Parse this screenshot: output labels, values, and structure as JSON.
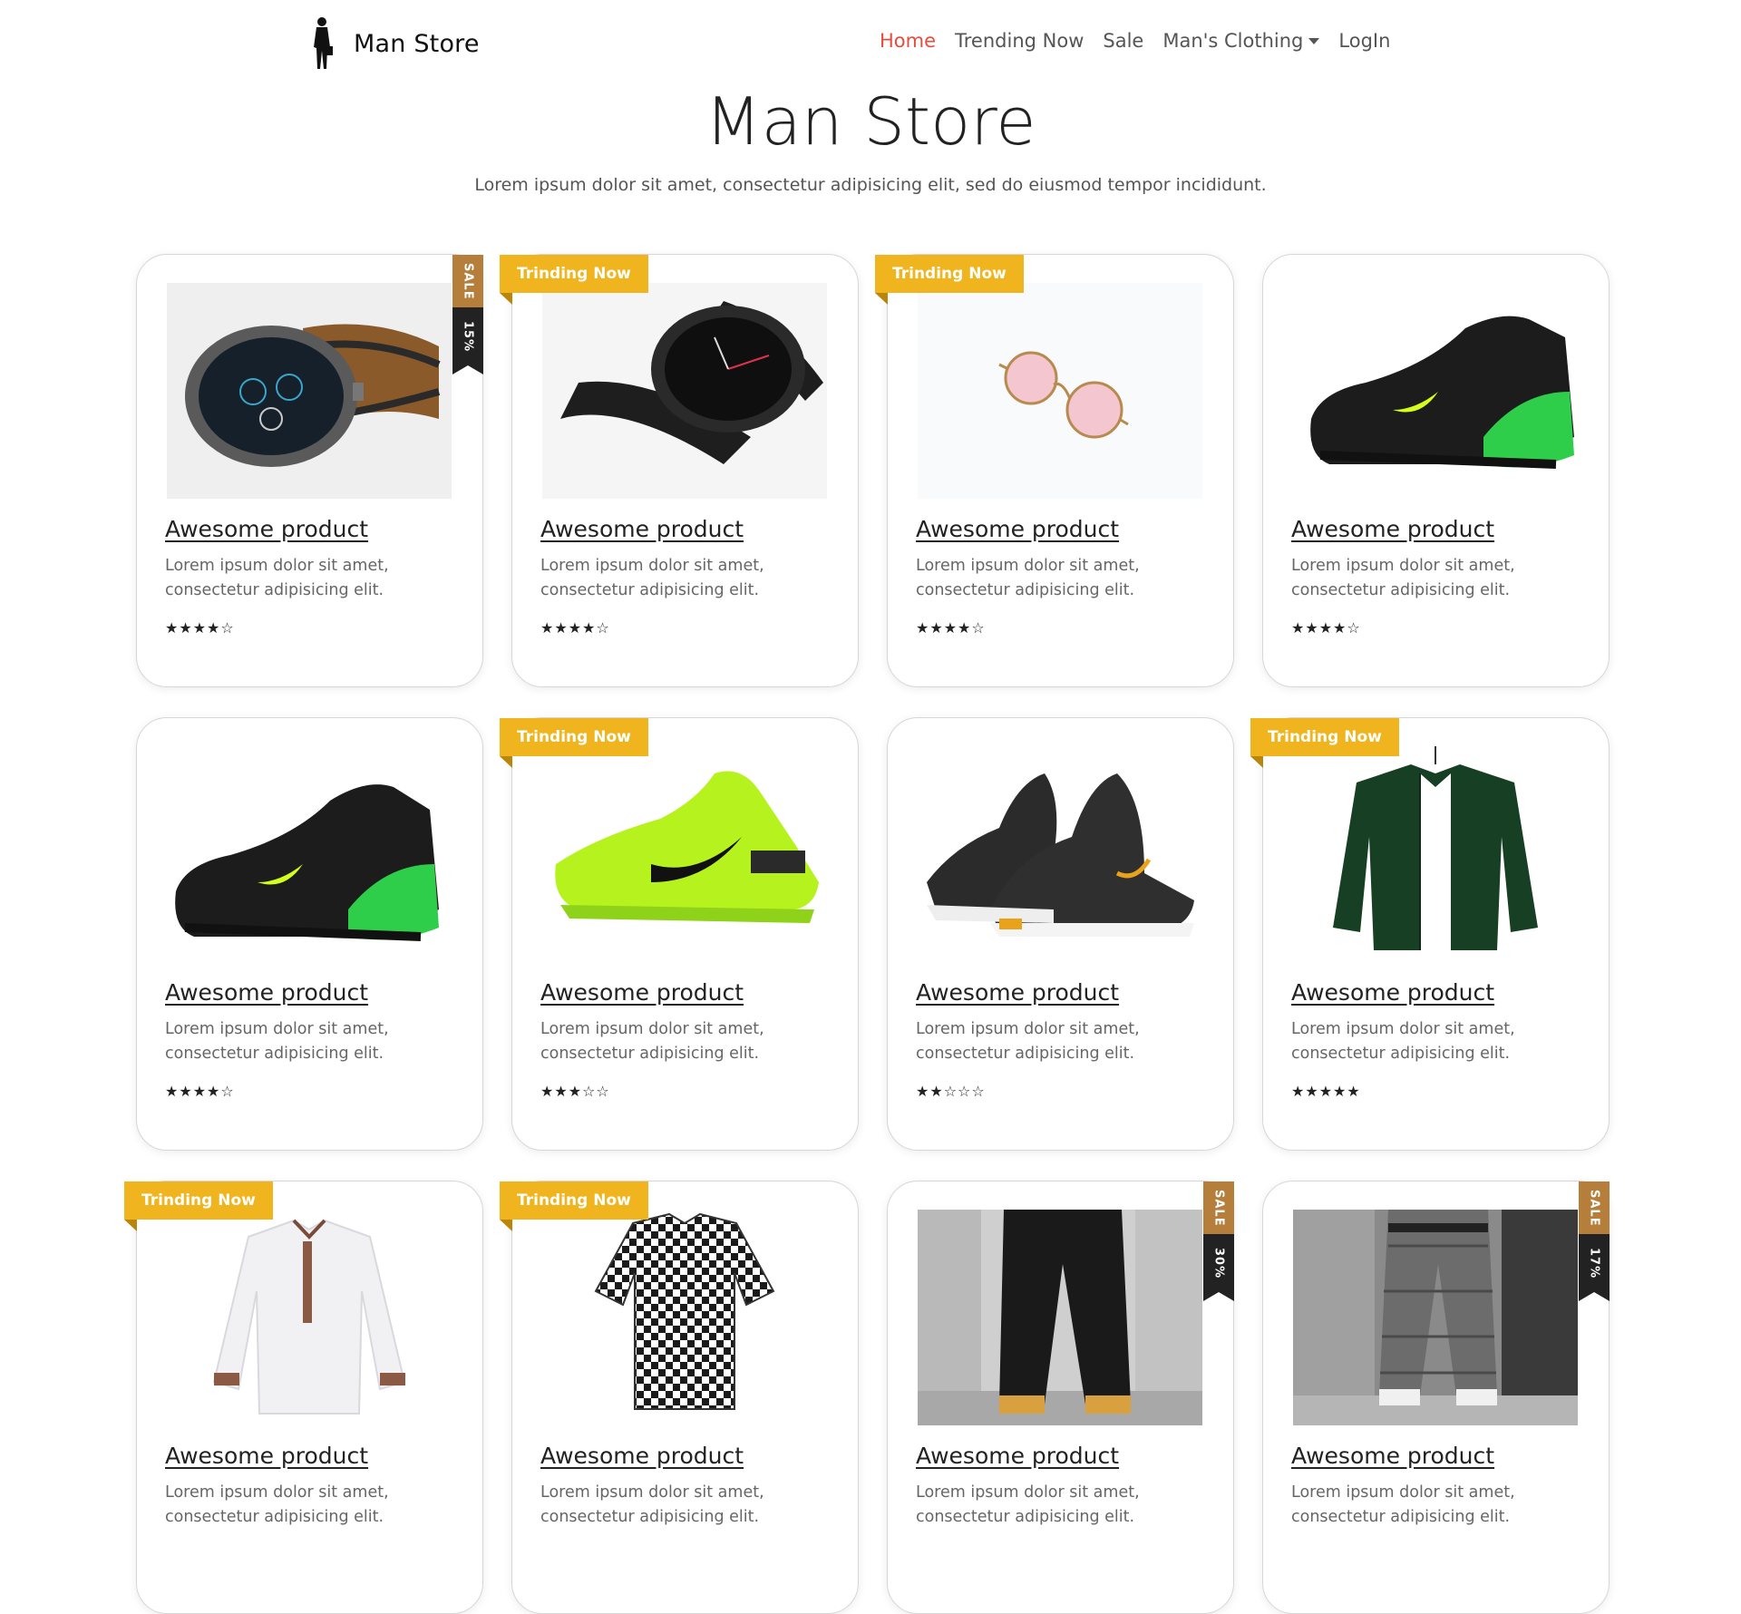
{
  "nav": {
    "brand": "Man Store",
    "links": [
      {
        "label": "Home",
        "active": true
      },
      {
        "label": "Trending Now",
        "active": false
      },
      {
        "label": "Sale",
        "active": false
      },
      {
        "label": "Man's Clothing",
        "active": false,
        "dropdown": true
      },
      {
        "label": "LogIn",
        "active": false
      }
    ]
  },
  "hero": {
    "title": "Man Store",
    "subtitle": "Lorem ipsum dolor sit amet, consectetur adipisicing elit, sed do eiusmod tempor incididunt."
  },
  "colors": {
    "accent": "#e84c3d",
    "trending": "#f0b51e",
    "sale": "#b57e3b",
    "sale_dark": "#222222"
  },
  "products": [
    {
      "image": "smartwatch-brown-strap",
      "title": "Awesome product",
      "desc": "Lorem ipsum dolor sit amet, consectetur adipisicing elit.",
      "rating": 4,
      "badge": "sale",
      "sale_label": "SALE",
      "discount": "15%"
    },
    {
      "image": "smartwatch-black-metal",
      "title": "Awesome product",
      "desc": "Lorem ipsum dolor sit amet, consectetur adipisicing elit.",
      "rating": 4,
      "badge": "trending",
      "trending_label": "Trinding Now"
    },
    {
      "image": "sunglasses-pink",
      "title": "Awesome product",
      "desc": "Lorem ipsum dolor sit amet, consectetur adipisicing elit.",
      "rating": 4,
      "badge": "trending",
      "trending_label": "Trinding Now"
    },
    {
      "image": "sneaker-black-green",
      "title": "Awesome product",
      "desc": "Lorem ipsum dolor sit amet, consectetur adipisicing elit.",
      "rating": 4,
      "badge": "none"
    },
    {
      "image": "sneaker-black-green",
      "title": "Awesome product",
      "desc": "Lorem ipsum dolor sit amet, consectetur adipisicing elit.",
      "rating": 4,
      "badge": "none"
    },
    {
      "image": "sneaker-neon",
      "title": "Awesome product",
      "desc": "Lorem ipsum dolor sit amet, consectetur adipisicing elit.",
      "rating": 3,
      "badge": "trending",
      "trending_label": "Trinding Now"
    },
    {
      "image": "sneaker-pair-black-white",
      "title": "Awesome product",
      "desc": "Lorem ipsum dolor sit amet, consectetur adipisicing elit.",
      "rating": 2,
      "badge": "none"
    },
    {
      "image": "jacket-green",
      "title": "Awesome product",
      "desc": "Lorem ipsum dolor sit amet, consectetur adipisicing elit.",
      "rating": 5,
      "badge": "trending",
      "trending_label": "Trinding Now"
    },
    {
      "image": "shirt-white",
      "title": "Awesome product",
      "desc": "Lorem ipsum dolor sit amet, consectetur adipisicing elit.",
      "rating": null,
      "badge": "trending",
      "trending_label": "Trinding Now"
    },
    {
      "image": "shirt-checkered",
      "title": "Awesome product",
      "desc": "Lorem ipsum dolor sit amet, consectetur adipisicing elit.",
      "rating": null,
      "badge": "trending",
      "trending_label": "Trinding Now"
    },
    {
      "image": "pants-black",
      "title": "Awesome product",
      "desc": "Lorem ipsum dolor sit amet, consectetur adipisicing elit.",
      "rating": null,
      "badge": "sale",
      "sale_label": "SALE",
      "discount": "30%"
    },
    {
      "image": "pants-plaid",
      "title": "Awesome product",
      "desc": "Lorem ipsum dolor sit amet, consectetur adipisicing elit.",
      "rating": null,
      "badge": "sale",
      "sale_label": "SALE",
      "discount": "17%"
    }
  ]
}
